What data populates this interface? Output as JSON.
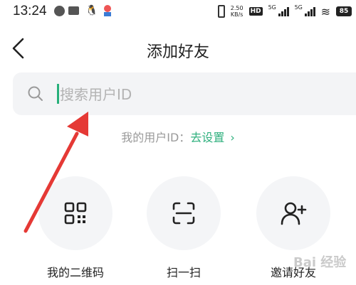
{
  "status_bar": {
    "time": "13:24",
    "speed": "2.50\nKB/s",
    "hd": "HD",
    "net1": "5G",
    "net2": "5G",
    "battery": "85"
  },
  "header": {
    "title": "添加好友",
    "back_icon": "chevron-left-icon"
  },
  "search": {
    "placeholder": "搜索用户ID",
    "value": ""
  },
  "my_id": {
    "label": "我的用户ID：",
    "link": "去设置",
    "chevron": "›"
  },
  "actions": [
    {
      "label": "我的二维码",
      "icon": "qr-code-icon"
    },
    {
      "label": "扫一扫",
      "icon": "scan-icon"
    },
    {
      "label": "邀请好友",
      "icon": "add-user-icon"
    }
  ],
  "colors": {
    "accent": "#2fb07e",
    "arrow": "#e53935"
  },
  "watermark": "Bai 经验"
}
